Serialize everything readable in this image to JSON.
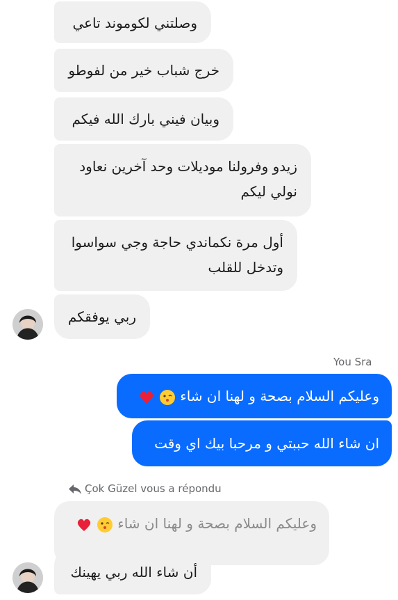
{
  "thread": {
    "incoming_messages": [
      {
        "text": "وصلتني لكوموند تاعي"
      },
      {
        "text": "خرج شباب خير من لفوطو"
      },
      {
        "text": "وبيان فيني بارك الله فيكم"
      },
      {
        "lines": [
          "زيدو وفرولنا موديلات وحد آخرين نعاود",
          "نولي ليكم"
        ]
      },
      {
        "lines": [
          "أول مرة نكماندي حاجة وجي سواسوا",
          "وتدخل للقلب"
        ]
      },
      {
        "text": "ربي يوفقكم"
      }
    ],
    "sender_label": "You Sra",
    "outgoing_messages": [
      {
        "text": "وعليكم السلام  بصحة و لهنا ان شاء",
        "emojis": [
          "kiss-face-icon",
          "red-heart-icon"
        ]
      },
      {
        "text": "ان شاء الله حببتي و مرحبا بيك اي وقت"
      }
    ],
    "reply_notice": "Çok Güzel vous a répondu",
    "quoted_message": {
      "text": "وعليكم السلام  بصحة و لهنا ان شاء",
      "emojis": [
        "kiss-face-icon",
        "red-heart-icon"
      ]
    },
    "reply_message": {
      "text": "أن شاء الله ربي يهينك"
    }
  },
  "colors": {
    "incoming_bg": "#f0f0f0",
    "outgoing_bg": "#0a6cff",
    "meta_text": "#65676b"
  }
}
